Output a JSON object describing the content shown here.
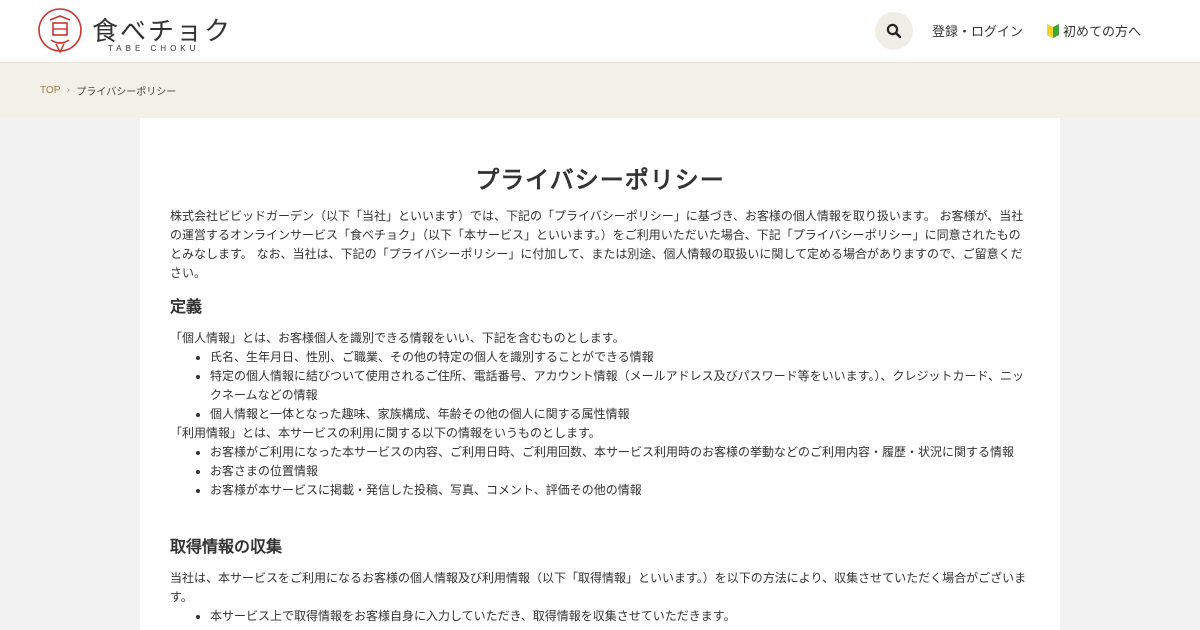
{
  "header": {
    "logo_name": "食べチョク",
    "logo_sub": "TABE CHOKU",
    "login_label": "登録・ログイン",
    "first_time_label": "初めての方へ"
  },
  "breadcrumb": {
    "top": "TOP",
    "current": "プライバシーポリシー"
  },
  "page": {
    "title": "プライバシーポリシー",
    "intro": "株式会社ビビッドガーデン（以下「当社」といいます）では、下記の「プライバシーポリシー」に基づき、お客様の個人情報を取り扱います。 お客様が、当社の運営するオンラインサービス「食べチョク」（以下「本サービス」といいます。）をご利用いただいた場合、下記「プライバシーポリシー」に同意されたものとみなします。 なお、当社は、下記の「プライバシーポリシー」に付加して、または別途、個人情報の取扱いに関して定める場合がありますので、ご留意ください。",
    "sections": [
      {
        "heading": "定義",
        "personal_lead": "「個人情報」とは、お客様個人を識別できる情報をいい、下記を含むものとします。",
        "personal_items": [
          "氏名、生年月日、性別、ご職業、その他の特定の個人を識別することができる情報",
          "特定の個人情報に結びついて使用されるご住所、電話番号、アカウント情報（メールアドレス及びパスワード等をいいます。）、クレジットカード、ニックネームなどの情報",
          "個人情報と一体となった趣味、家族構成、年齢その他の個人に関する属性情報"
        ],
        "usage_lead": "「利用情報」とは、本サービスの利用に関する以下の情報をいうものとします。",
        "usage_items": [
          "お客様がご利用になった本サービスの内容、ご利用日時、ご利用回数、本サービス利用時のお客様の挙動などのご利用内容・履歴・状況に関する情報",
          "お客さまの位置情報",
          "お客様が本サービスに掲載・発信した投稿、写真、コメント、評価その他の情報"
        ]
      },
      {
        "heading": "取得情報の収集",
        "lead": "当社は、本サービスをご利用になるお客様の個人情報及び利用情報（以下「取得情報」といいます。）を以下の方法により、収集させていただく場合がございます。",
        "items": [
          "本サービス上で取得情報をお客様自身に入力していただき、取得情報を収集させていただきます。"
        ]
      }
    ]
  },
  "icons": {
    "search": "search-icon",
    "beginner": "beginner-mark-icon"
  },
  "colors": {
    "logo_red": "#c8352e",
    "breadcrumb_link": "#a07c4a",
    "crumb_bg": "#f3f0e8",
    "beginner_green": "#3fa535",
    "beginner_yellow": "#f2d22e"
  }
}
